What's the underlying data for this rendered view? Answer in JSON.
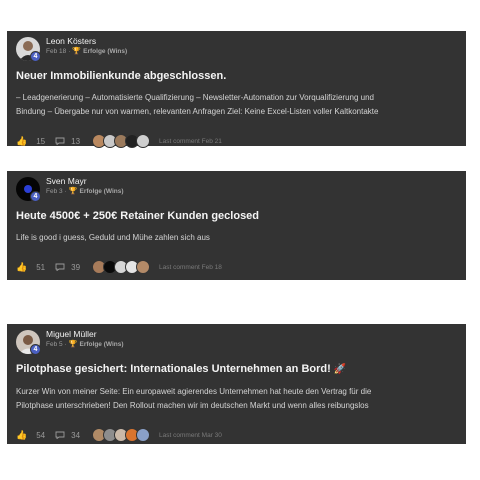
{
  "posts": [
    {
      "author": "Leon Kösters",
      "level": "4",
      "date": "Feb 18",
      "category": "Erfolge (Wins)",
      "title": "Neuer Immobilienkunde abgeschlossen.",
      "body_lines": [
        "– Leadgenerierung – Automatisierte Qualifizierung – Newsletter-Automation zur Vorqualifizierung und",
        "Bindung – Übergabe nur von warmen, relevanten Anfragen Ziel: Keine Excel-Listen voller Kaltkontakte"
      ],
      "likes": "15",
      "comments": "13",
      "last_comment": "Last comment Feb 21"
    },
    {
      "author": "Sven Mayr",
      "level": "4",
      "date": "Feb 3",
      "category": "Erfolge (Wins)",
      "title": "Heute 4500€ + 250€ Retainer Kunden geclosed",
      "body_lines": [
        "Life is good i guess, Geduld und Mühe zahlen sich aus"
      ],
      "likes": "51",
      "comments": "39",
      "last_comment": "Last comment Feb 18"
    },
    {
      "author": "Miguel Müller",
      "level": "4",
      "date": "Feb 5",
      "category": "Erfolge (Wins)",
      "title": "Pilotphase gesichert: Internationales Unternehmen an Bord!",
      "title_emoji": "🚀",
      "body_lines": [
        "Kurzer Win von meiner Seite: Ein europaweit agierendes Unternehmen hat heute den Vertrag für die",
        "Pilotphase unterschrieben! Den Rollout machen wir im deutschen Markt und wenn alles reibungslos"
      ],
      "likes": "54",
      "comments": "34",
      "last_comment": "Last comment Mar 30"
    }
  ],
  "icons": {
    "like": "thumbs-up-icon",
    "comment": "comment-icon",
    "category": "trophy-icon"
  },
  "colors": {
    "card_bg": "#333333",
    "accent": "#e8b12a",
    "level_badge": "#4a5fc1"
  }
}
